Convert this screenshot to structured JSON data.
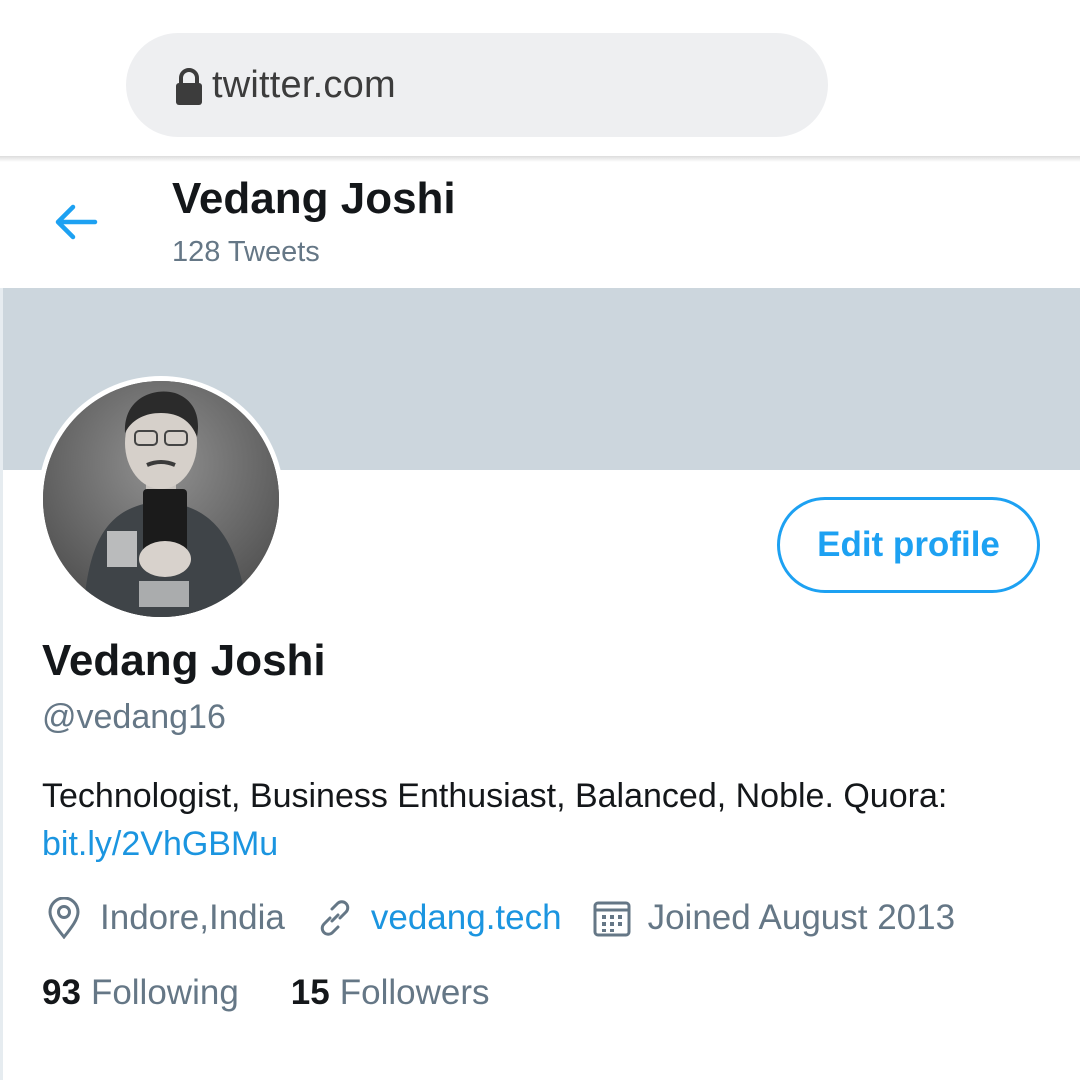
{
  "browser": {
    "url": "twitter.com",
    "lock_icon": "lock-icon"
  },
  "header": {
    "back_icon": "arrow-left-icon",
    "name": "Vedang Joshi",
    "tweets_count": "128 Tweets"
  },
  "profile": {
    "edit_button_label": "Edit profile",
    "name": "Vedang Joshi",
    "handle": "@vedang16",
    "bio_text": "Technologist, Business Enthusiast, Balanced, Noble. Quora:",
    "bio_link": "bit.ly/2VhGBMu",
    "location": "Indore,India",
    "website": "vedang.tech",
    "joined": "Joined August 2013",
    "following_count": "93",
    "following_label": "Following",
    "followers_count": "15",
    "followers_label": "Followers"
  },
  "colors": {
    "accent": "#1da1f2",
    "link": "#1b95e0",
    "banner": "#ccd6dd",
    "secondary_text": "#657786",
    "primary_text": "#14171a"
  }
}
